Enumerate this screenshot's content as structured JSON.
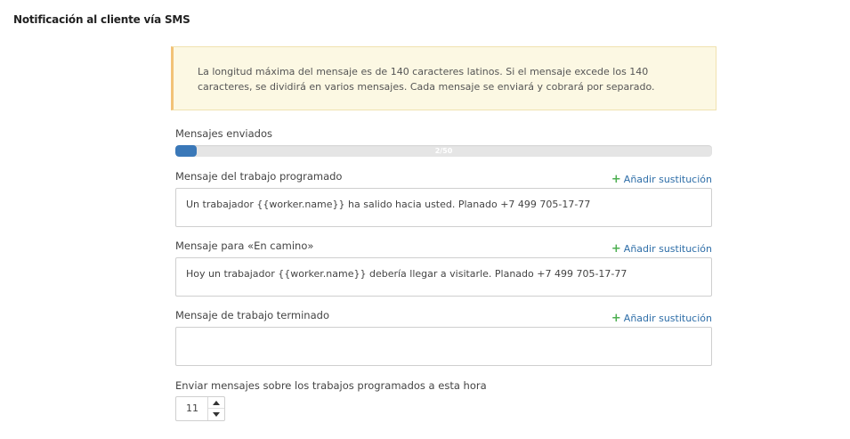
{
  "section": {
    "title": "Notificación al cliente vía SMS"
  },
  "alert": {
    "text": "La longitud máxima del mensaje es de 140 caracteres latinos. Si el mensaje excede los 140 caracteres, se dividirá en varios mensajes. Cada mensaje se enviará y cobrará por separado."
  },
  "sent": {
    "label": "Mensajes enviados",
    "progress_text": "2/50",
    "used": 2,
    "total": 50
  },
  "messages": [
    {
      "label": "Mensaje del trabajo programado",
      "add_label": "Añadir sustitución",
      "value": "Un trabajador {{worker.name}} ha salido hacia usted. Planado +7 499 705-17-77"
    },
    {
      "label": "Mensaje para «En camino»",
      "add_label": "Añadir sustitución",
      "value": "Hoy un trabajador {{worker.name}} debería llegar a visitarle.  Planado +7 499 705-17-77"
    },
    {
      "label": "Mensaje de trabajo terminado",
      "add_label": "Añadir sustitución",
      "value": ""
    }
  ],
  "schedule": {
    "label": "Enviar mensajes sobre los trabajos programados a esta hora",
    "hour": "11"
  },
  "colors": {
    "alert_background": "#fcf8e3",
    "alert_accent": "#f2c277",
    "progress_fill": "#3a78b8",
    "link": "#2e6ea8",
    "plus": "#4caf50"
  },
  "icons": {
    "add": "plus-icon",
    "increment": "caret-up-icon",
    "decrement": "caret-down-icon"
  }
}
